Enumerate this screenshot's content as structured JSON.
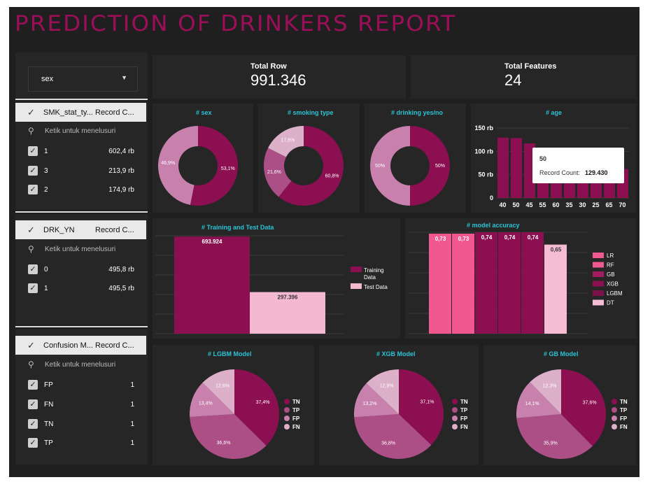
{
  "title": "PREDICTION OF DRINKERS REPORT",
  "dropdown": {
    "label": "sex"
  },
  "filters": [
    {
      "col1": "SMK_stat_ty...",
      "col2": "Record C...",
      "search": "Ketik untuk menelusuri",
      "rows": [
        {
          "name": "1",
          "value": "602,4 rb"
        },
        {
          "name": "3",
          "value": "213,9 rb"
        },
        {
          "name": "2",
          "value": "174,9 rb"
        }
      ]
    },
    {
      "col1": "DRK_YN",
      "col2": "Record C...",
      "search": "Ketik untuk menelusuri",
      "rows": [
        {
          "name": "0",
          "value": "495,8 rb"
        },
        {
          "name": "1",
          "value": "495,5 rb"
        }
      ]
    },
    {
      "col1": "Confusion M...",
      "col2": "Record C...",
      "search": "Ketik untuk menelusuri",
      "rows": [
        {
          "name": "FP",
          "value": "1"
        },
        {
          "name": "FN",
          "value": "1"
        },
        {
          "name": "TN",
          "value": "1"
        },
        {
          "name": "TP",
          "value": "1"
        }
      ]
    }
  ],
  "kpis": [
    {
      "label": "Total Row",
      "value": "991.346"
    },
    {
      "label": "Total Features",
      "value": "24"
    }
  ],
  "colors": {
    "magenta": "#8c0f52",
    "mid": "#ab4f86",
    "light": "#c880ad",
    "pale": "#dcb0c9",
    "accent": "#2ac3d6"
  },
  "chart_data": [
    {
      "type": "pie",
      "title": "# sex",
      "donut": true,
      "labels": [
        "53,1%",
        "46,9%"
      ],
      "values": [
        53.1,
        46.9
      ]
    },
    {
      "type": "pie",
      "title": "# smoking type",
      "donut": true,
      "labels": [
        "60,8%",
        "21,6%",
        "17,6%"
      ],
      "values": [
        60.8,
        21.6,
        17.6
      ]
    },
    {
      "type": "pie",
      "title": "# drinking yes/no",
      "donut": true,
      "labels": [
        "50%",
        "50%"
      ],
      "values": [
        50,
        50
      ]
    },
    {
      "type": "bar",
      "title": "# age",
      "categories": [
        "40",
        "50",
        "45",
        "55",
        "60",
        "35",
        "30",
        "25",
        "65",
        "70"
      ],
      "values": [
        129.43,
        128.5,
        117,
        106,
        90,
        82,
        76,
        74,
        68,
        62
      ],
      "yticks": [
        "0",
        "50 rb",
        "100 rb",
        "150 rb"
      ],
      "ylim": [
        0,
        150
      ],
      "tooltip": {
        "title": "50",
        "label": "Record Count:",
        "value": "129.430"
      }
    },
    {
      "type": "bar",
      "title": "# Training and Test Data",
      "series": [
        {
          "name": "Training Data",
          "values": [
            693924
          ],
          "label": "693.924"
        },
        {
          "name": "Test Data",
          "values": [
            297396
          ],
          "label": "297.396"
        }
      ],
      "ylim": [
        0,
        800000
      ]
    },
    {
      "type": "bar",
      "title": "# model accuracy",
      "categories": [
        "LR",
        "RF",
        "GB",
        "XGB",
        "LGBM",
        "DT"
      ],
      "values": [
        0.73,
        0.73,
        0.74,
        0.74,
        0.74,
        0.65
      ],
      "labels": [
        "0,73",
        "0,73",
        "0,74",
        "0,74",
        "0,74",
        "0,65"
      ]
    },
    {
      "type": "pie",
      "title": "# LGBM Model",
      "legend": [
        "TN",
        "TP",
        "FP",
        "FN"
      ],
      "values": [
        37.4,
        36.6,
        13.4,
        12.6
      ],
      "labels": [
        "37,4%",
        "36,6%",
        "13,4%",
        "12,6%"
      ]
    },
    {
      "type": "pie",
      "title": "# XGB Model",
      "legend": [
        "TN",
        "TP",
        "FP",
        "FN"
      ],
      "values": [
        37.1,
        36.8,
        13.2,
        12.9
      ],
      "labels": [
        "37,1%",
        "36,8%",
        "13,2%",
        "12,9%"
      ]
    },
    {
      "type": "pie",
      "title": "# GB Model",
      "legend": [
        "TN",
        "TP",
        "FP",
        "FN"
      ],
      "values": [
        37.6,
        35.9,
        14.1,
        12.3
      ],
      "labels": [
        "37,6%",
        "35,9%",
        "14,1%",
        "12,3%"
      ]
    }
  ]
}
